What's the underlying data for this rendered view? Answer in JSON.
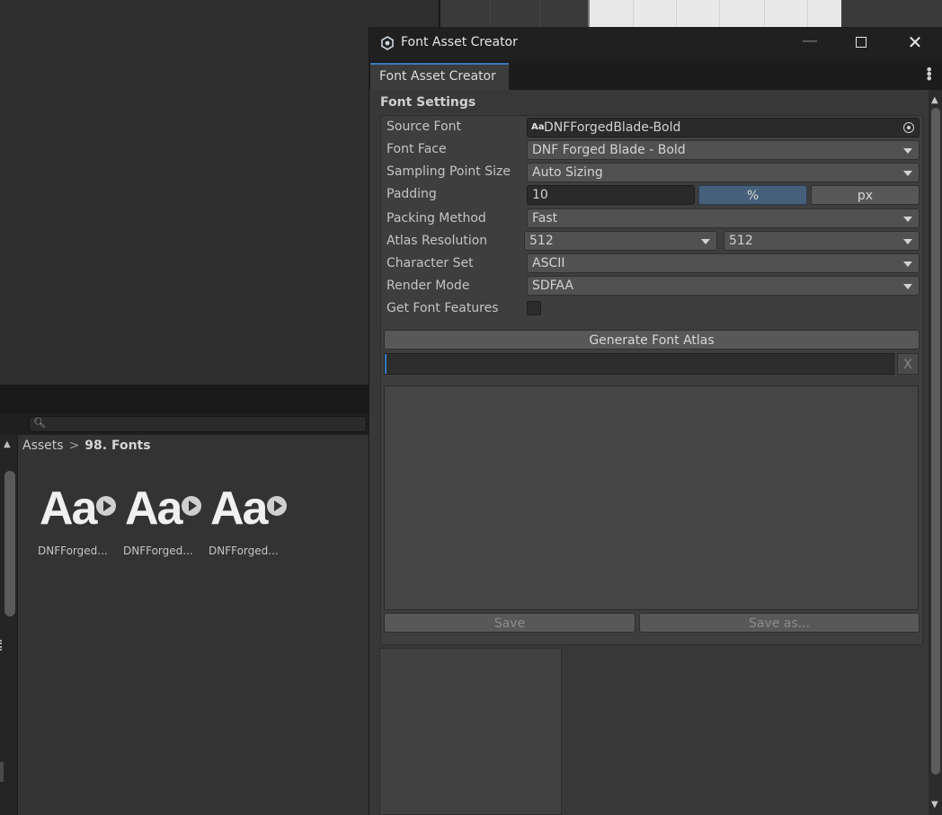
{
  "window": {
    "title": "Font Asset Creator",
    "tab_label": "Font Asset Creator"
  },
  "project": {
    "breadcrumb": {
      "root": "Assets",
      "separator": ">",
      "current": "98. Fonts"
    },
    "assets": [
      {
        "glyph": "Aa",
        "name": "DNFForged..."
      },
      {
        "glyph": "Aa",
        "name": "DNFForged..."
      },
      {
        "glyph": "Aa",
        "name": "DNFForged..."
      }
    ]
  },
  "font_settings": {
    "section_title": "Font Settings",
    "source_font": {
      "label": "Source Font",
      "icon_text": "Aa",
      "value": "DNFForgedBlade-Bold"
    },
    "font_face": {
      "label": "Font Face",
      "value": "DNF Forged Blade - Bold"
    },
    "sampling_point_size": {
      "label": "Sampling Point Size",
      "value": "Auto Sizing"
    },
    "padding": {
      "label": "Padding",
      "value": "10",
      "percent_label": "%",
      "px_label": "px",
      "selected_unit": "%"
    },
    "packing_method": {
      "label": "Packing Method",
      "value": "Fast"
    },
    "atlas_resolution": {
      "label": "Atlas Resolution",
      "width": "512",
      "height": "512"
    },
    "character_set": {
      "label": "Character Set",
      "value": "ASCII"
    },
    "render_mode": {
      "label": "Render Mode",
      "value": "SDFAA"
    },
    "get_font_features": {
      "label": "Get Font Features",
      "checked": false
    }
  },
  "actions": {
    "generate_label": "Generate Font Atlas",
    "progress": 0.004,
    "cancel_label": "X",
    "save_label": "Save",
    "save_as_label": "Save as..."
  },
  "colors": {
    "accent": "#3a79bb",
    "selected_toggle": "#46607c"
  },
  "icons": {
    "window": "unity-gear-icon",
    "source_picker": "object-picker-icon",
    "search": "search-icon",
    "play": "play-icon"
  }
}
